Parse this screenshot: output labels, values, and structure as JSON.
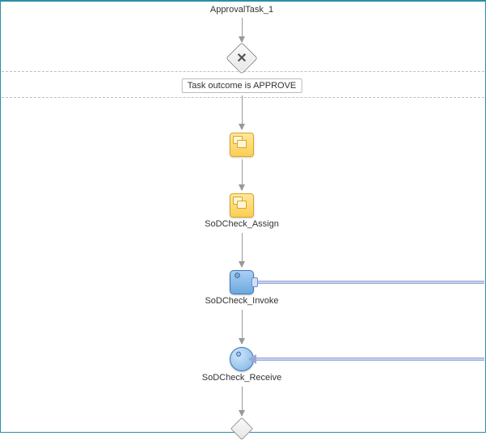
{
  "diagram": {
    "nodes": {
      "approvalTask": {
        "label": "ApprovalTask_1"
      },
      "gateway": {
        "badge": "Task outcome is APPROVE"
      },
      "assign1": {
        "label": ""
      },
      "assign2": {
        "label": "SoDCheck_Assign"
      },
      "invoke": {
        "label": "SoDCheck_Invoke"
      },
      "receive": {
        "label": "SoDCheck_Receive"
      }
    }
  }
}
